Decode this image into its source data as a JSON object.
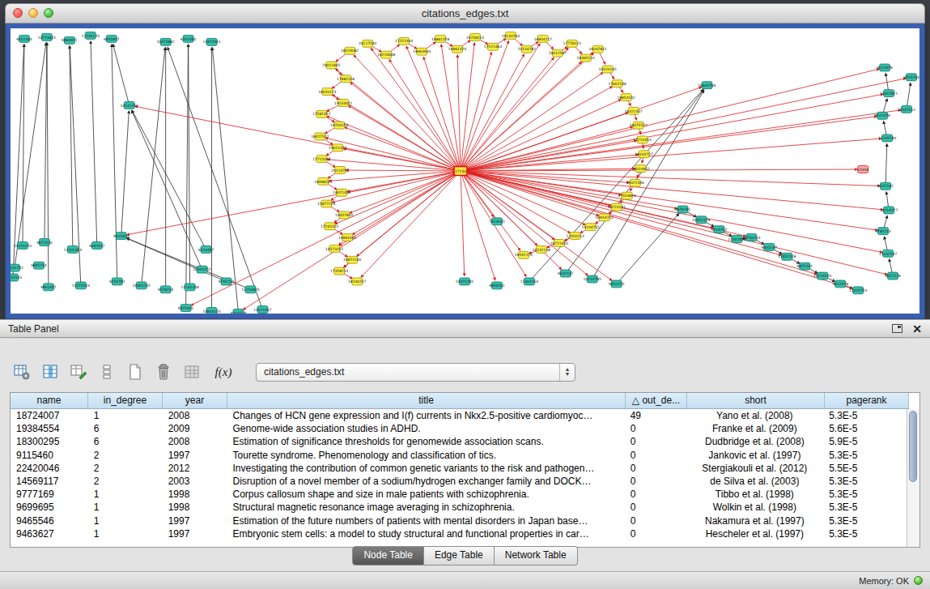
{
  "window": {
    "title": "citations_edges.txt"
  },
  "table_panel": {
    "title": "Table Panel",
    "header_icons": [
      "float-icon",
      "close-icon"
    ],
    "toolbar": {
      "icons": [
        "table-settings",
        "select-columns",
        "edit-table",
        "row-tools",
        "new-table",
        "delete-table",
        "import-table",
        "function-builder"
      ],
      "fx_label": "f(x)",
      "dropdown_value": "citations_edges.txt"
    },
    "columns": [
      "name",
      "in_degree",
      "year",
      "title",
      "out_de...",
      "short",
      "pagerank"
    ],
    "sort_column_index": 4,
    "sort_indicator": "△",
    "rows": [
      [
        "18724007",
        "1",
        "2008",
        "Changes of HCN gene expression and I(f) currents in Nkx2.5-positive cardiomyoc…",
        "49",
        "Yano et al. (2008)",
        "5.3E-5"
      ],
      [
        "19384554",
        "6",
        "2009",
        "Genome-wide association studies in ADHD.",
        "0",
        "Franke et al. (2009)",
        "5.6E-5"
      ],
      [
        "18300295",
        "6",
        "2008",
        "Estimation of significance thresholds for genomewide association scans.",
        "0",
        "Dudbridge et al. (2008)",
        "5.9E-5"
      ],
      [
        "9115460",
        "2",
        "1997",
        "Tourette syndrome. Phenomenology and classification of tics.",
        "0",
        "Jankovic et al. (1997)",
        "5.3E-5"
      ],
      [
        "22420046",
        "2",
        "2012",
        "Investigating the contribution of common genetic variants to the risk and pathogen…",
        "0",
        "Stergiakouli et al. (2012)",
        "5.5E-5"
      ],
      [
        "14569117",
        "2",
        "2003",
        "Disruption of a novel member of a sodium/hydrogen exchanger family and DOCK…",
        "0",
        "de Silva et al. (2003)",
        "5.3E-5"
      ],
      [
        "9777169",
        "1",
        "1998",
        "Corpus callosum shape and size in male patients with schizophrenia.",
        "0",
        "Tibbo et al. (1998)",
        "5.3E-5"
      ],
      [
        "9699695",
        "1",
        "1998",
        "Structural magnetic resonance image averaging in schizophrenia.",
        "0",
        "Wolkin et al. (1998)",
        "5.3E-5"
      ],
      [
        "9465546",
        "1",
        "1997",
        "Estimation of the future numbers of patients with mental disorders in Japan base…",
        "0",
        "Nakamura et al. (1997)",
        "5.3E-5"
      ],
      [
        "9463627",
        "1",
        "1997",
        "Embryonic stem cells: a model to study structural and functional properties in car…",
        "0",
        "Hescheler et al. (1997)",
        "5.3E-5"
      ]
    ],
    "tabs": [
      {
        "label": "Node Table",
        "selected": true
      },
      {
        "label": "Edge Table",
        "selected": false
      },
      {
        "label": "Network Table",
        "selected": false
      }
    ]
  },
  "status": {
    "memory_label": "Memory: OK"
  },
  "graph": {
    "colors": {
      "edge_black": "#2a2a2a",
      "edge_red": "#dd1c1c",
      "node_yellow": "#f8ef3f",
      "node_yellow_border": "#9c8f00",
      "node_teal": "#35c1ab",
      "node_teal_border": "#0d7668",
      "node_hub": "#ffe63e",
      "node_red_fill": "#ffadad",
      "node_red_border": "#dd1111"
    },
    "nodes": [
      [
        557,
        178,
        "h",
        "17240"
      ],
      [
        420,
        28,
        "y",
        "18524082"
      ],
      [
        397,
        46,
        "y",
        "20011845"
      ],
      [
        415,
        63,
        "y",
        "17882206"
      ],
      [
        392,
        79,
        "y",
        "16020174"
      ],
      [
        412,
        93,
        "y",
        "19154021"
      ],
      [
        385,
        107,
        "y",
        "17581452"
      ],
      [
        407,
        121,
        "y",
        "18700154"
      ],
      [
        383,
        135,
        "y",
        "16427512"
      ],
      [
        405,
        149,
        "y",
        "19011475"
      ],
      [
        385,
        163,
        "y",
        "17712045"
      ],
      [
        408,
        177,
        "y",
        "20114752"
      ],
      [
        387,
        191,
        "y",
        "16998201"
      ],
      [
        410,
        205,
        "y",
        "18321450"
      ],
      [
        391,
        219,
        "y",
        "15877214"
      ],
      [
        413,
        233,
        "y",
        "19457820"
      ],
      [
        395,
        247,
        "y",
        "17245102"
      ],
      [
        417,
        261,
        "y",
        "18991045"
      ],
      [
        401,
        275,
        "y",
        "16573201"
      ],
      [
        423,
        289,
        "y",
        "19872140"
      ],
      [
        407,
        303,
        "y",
        "17358214"
      ],
      [
        429,
        316,
        "y",
        "18140257"
      ],
      [
        442,
        19,
        "y",
        "20117540"
      ],
      [
        465,
        33,
        "y",
        "18220648"
      ],
      [
        487,
        16,
        "y",
        "17251404"
      ],
      [
        509,
        29,
        "y",
        "19663904"
      ],
      [
        532,
        13,
        "y",
        "16861378"
      ],
      [
        553,
        26,
        "y",
        "18961374"
      ],
      [
        575,
        11,
        "y",
        "19758214"
      ],
      [
        597,
        23,
        "y",
        "17521463"
      ],
      [
        619,
        9,
        "y",
        "18130764"
      ],
      [
        639,
        26,
        "y",
        "20154782"
      ],
      [
        659,
        13,
        "y",
        "16854217"
      ],
      [
        677,
        31,
        "y",
        "19012547"
      ],
      [
        695,
        19,
        "y",
        "17778123"
      ],
      [
        712,
        37,
        "y",
        "18465120"
      ],
      [
        727,
        26,
        "y",
        "16047821"
      ],
      [
        739,
        51,
        "y",
        "19320145"
      ],
      [
        751,
        69,
        "y",
        "17602148"
      ],
      [
        762,
        86,
        "y",
        "18854102"
      ],
      [
        771,
        103,
        "y",
        "16321457"
      ],
      [
        777,
        121,
        "y",
        "19475512"
      ],
      [
        782,
        139,
        "y",
        "17210453"
      ],
      [
        784,
        157,
        "y",
        "18104727"
      ],
      [
        780,
        175,
        "y",
        "16014852"
      ],
      [
        773,
        193,
        "y",
        "19321046"
      ],
      [
        763,
        209,
        "y",
        "17554820"
      ],
      [
        750,
        223,
        "y",
        "18220141"
      ],
      [
        735,
        236,
        "y",
        "16954710"
      ],
      [
        718,
        248,
        "y",
        "19104752"
      ],
      [
        699,
        259,
        "y",
        "17450213"
      ],
      [
        679,
        268,
        "y",
        "18721450"
      ],
      [
        657,
        276,
        "y",
        "16232148"
      ],
      [
        635,
        283,
        "y",
        "19542170"
      ],
      [
        17,
        13,
        "t",
        "9152304"
      ],
      [
        45,
        11,
        "t",
        "10274815"
      ],
      [
        73,
        15,
        "t",
        "9864021"
      ],
      [
        99,
        9,
        "t",
        "11245170"
      ],
      [
        125,
        13,
        "t",
        "9452817"
      ],
      [
        192,
        17,
        "t",
        "10475882"
      ],
      [
        220,
        13,
        "t",
        "9321450"
      ],
      [
        249,
        17,
        "t",
        "11872041"
      ],
      [
        147,
        96,
        "t",
        "10531704"
      ],
      [
        137,
        259,
        "t",
        "9915824"
      ],
      [
        15,
        271,
        "t",
        "10254170"
      ],
      [
        42,
        267,
        "t",
        "9471520"
      ],
      [
        77,
        276,
        "t",
        "11201453"
      ],
      [
        107,
        271,
        "t",
        "9687412"
      ],
      [
        5,
        299,
        "t",
        "10141752"
      ],
      [
        35,
        296,
        "t",
        "9805214"
      ],
      [
        87,
        321,
        "t",
        "11475203"
      ],
      [
        132,
        316,
        "t",
        "9254781"
      ],
      [
        162,
        321,
        "t",
        "10901245"
      ],
      [
        192,
        326,
        "t",
        "9578214"
      ],
      [
        222,
        323,
        "t",
        "11145208"
      ],
      [
        47,
        323,
        "t",
        "9901457"
      ],
      [
        3,
        311,
        "t",
        "10232145"
      ],
      [
        217,
        349,
        "t",
        "9475301"
      ],
      [
        249,
        353,
        "t",
        "10854120"
      ],
      [
        282,
        355,
        "t",
        "9214578"
      ],
      [
        312,
        351,
        "t",
        "11021457"
      ],
      [
        237,
        301,
        "t",
        "10332152"
      ],
      [
        267,
        316,
        "t",
        "9745210"
      ],
      [
        297,
        326,
        "t",
        "11254870"
      ],
      [
        242,
        276,
        "t",
        "9120457"
      ],
      [
        562,
        316,
        "t",
        "10471285"
      ],
      [
        602,
        321,
        "t",
        "9854201"
      ],
      [
        642,
        316,
        "t",
        "11302154"
      ],
      [
        687,
        306,
        "t",
        "9632147"
      ],
      [
        720,
        313,
        "t",
        "10214785"
      ],
      [
        750,
        319,
        "t",
        "9452170"
      ],
      [
        602,
        241,
        "t",
        "1914545"
      ],
      [
        917,
        261,
        "t",
        "10750214"
      ],
      [
        939,
        273,
        "t",
        "9302147"
      ],
      [
        961,
        285,
        "t",
        "11452108"
      ],
      [
        983,
        297,
        "t",
        "9875201"
      ],
      [
        1005,
        309,
        "t",
        "10214570"
      ],
      [
        1027,
        319,
        "t",
        "9612478"
      ],
      [
        1049,
        327,
        "t",
        "11024753"
      ],
      [
        832,
        226,
        "t",
        "9879191"
      ],
      [
        855,
        239,
        "t",
        "10452178"
      ],
      [
        877,
        251,
        "t",
        "9214752"
      ],
      [
        899,
        263,
        "t",
        "11302458"
      ],
      [
        862,
        71,
        "t",
        "16643794"
      ],
      [
        1115,
        61,
        "t",
        "9755214"
      ],
      [
        1109,
        101,
        "t",
        "10247512"
      ],
      [
        1082,
        49,
        "t",
        "9152478"
      ],
      [
        1087,
        81,
        "t",
        "10457821"
      ],
      [
        1079,
        109,
        "t",
        "9321478"
      ],
      [
        1085,
        137,
        "t",
        "11245780"
      ],
      [
        1083,
        197,
        "t",
        "9547102"
      ],
      [
        1087,
        227,
        "t",
        "10214577"
      ],
      [
        1080,
        253,
        "t",
        "9785214"
      ],
      [
        1086,
        281,
        "t",
        "11032547"
      ],
      [
        1092,
        309,
        "t",
        "9452178"
      ],
      [
        1055,
        176,
        "r",
        "15958"
      ]
    ],
    "red_targets": [
      1,
      2,
      3,
      4,
      5,
      6,
      7,
      8,
      9,
      10,
      11,
      12,
      13,
      14,
      15,
      16,
      17,
      18,
      19,
      20,
      21,
      22,
      23,
      24,
      25,
      26,
      27,
      28,
      29,
      30,
      31,
      32,
      33,
      34,
      35,
      36,
      37,
      38,
      39,
      40,
      41,
      42,
      43,
      44,
      45,
      46,
      47,
      48,
      49,
      50,
      51,
      52,
      53,
      62,
      63,
      77,
      79,
      85,
      86,
      87,
      88,
      89,
      90,
      91,
      92,
      94,
      96,
      98,
      99,
      101,
      103,
      104,
      105,
      106,
      107,
      108,
      109,
      110,
      111,
      112,
      113,
      114,
      115
    ],
    "red_pairs": [
      [
        1,
        2
      ],
      [
        2,
        3
      ],
      [
        3,
        4
      ],
      [
        4,
        5
      ],
      [
        5,
        6
      ],
      [
        6,
        7
      ],
      [
        7,
        8
      ],
      [
        8,
        9
      ],
      [
        9,
        10
      ],
      [
        10,
        11
      ],
      [
        11,
        12
      ],
      [
        12,
        13
      ],
      [
        13,
        14
      ],
      [
        14,
        15
      ],
      [
        15,
        16
      ],
      [
        16,
        17
      ],
      [
        17,
        18
      ],
      [
        18,
        19
      ],
      [
        19,
        20
      ],
      [
        20,
        21
      ],
      [
        22,
        23
      ],
      [
        23,
        24
      ],
      [
        24,
        25
      ],
      [
        25,
        26
      ],
      [
        26,
        27
      ],
      [
        27,
        28
      ],
      [
        28,
        29
      ],
      [
        29,
        30
      ],
      [
        30,
        31
      ],
      [
        31,
        32
      ],
      [
        32,
        33
      ],
      [
        33,
        34
      ],
      [
        34,
        35
      ],
      [
        35,
        36
      ],
      [
        36,
        37
      ],
      [
        37,
        38
      ],
      [
        38,
        39
      ],
      [
        39,
        40
      ],
      [
        40,
        41
      ],
      [
        41,
        42
      ],
      [
        42,
        43
      ],
      [
        43,
        44
      ],
      [
        44,
        45
      ],
      [
        45,
        46
      ],
      [
        46,
        47
      ],
      [
        47,
        48
      ],
      [
        48,
        49
      ],
      [
        49,
        50
      ],
      [
        50,
        51
      ],
      [
        51,
        52
      ],
      [
        52,
        53
      ]
    ],
    "black_edges": [
      [
        76,
        54
      ],
      [
        68,
        55
      ],
      [
        75,
        55
      ],
      [
        70,
        56
      ],
      [
        67,
        57
      ],
      [
        71,
        58
      ],
      [
        63,
        62
      ],
      [
        72,
        59
      ],
      [
        73,
        59
      ],
      [
        74,
        60
      ],
      [
        77,
        60
      ],
      [
        78,
        61
      ],
      [
        64,
        54
      ],
      [
        65,
        55
      ],
      [
        66,
        56
      ],
      [
        62,
        58
      ],
      [
        79,
        61
      ],
      [
        80,
        59
      ],
      [
        81,
        62
      ],
      [
        84,
        62
      ],
      [
        82,
        63
      ],
      [
        83,
        63
      ],
      [
        88,
        103
      ],
      [
        89,
        103
      ],
      [
        87,
        103
      ],
      [
        92,
        93
      ],
      [
        93,
        94
      ],
      [
        94,
        95
      ],
      [
        95,
        96
      ],
      [
        96,
        97
      ],
      [
        97,
        98
      ],
      [
        99,
        100
      ],
      [
        100,
        101
      ],
      [
        101,
        102
      ],
      [
        102,
        92
      ],
      [
        90,
        99
      ],
      [
        114,
        113
      ],
      [
        113,
        112
      ],
      [
        112,
        111
      ],
      [
        111,
        110
      ],
      [
        110,
        109
      ],
      [
        109,
        108
      ],
      [
        108,
        107
      ],
      [
        107,
        106
      ],
      [
        105,
        104
      ]
    ]
  }
}
